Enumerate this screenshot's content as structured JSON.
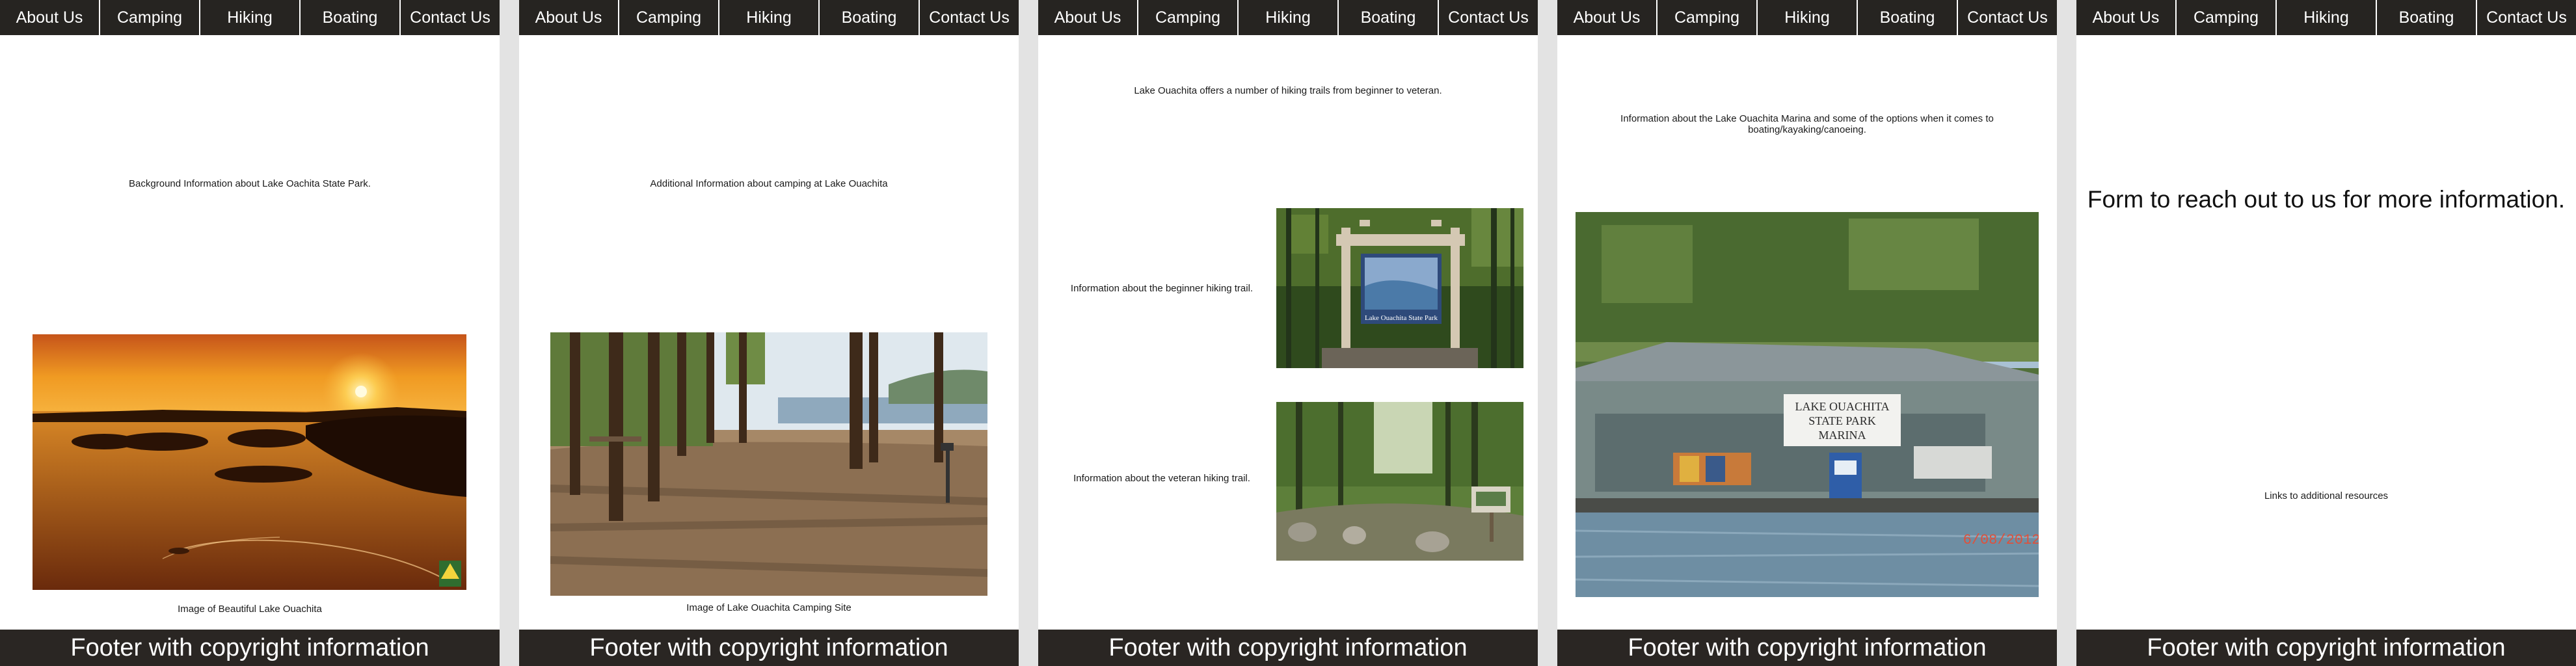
{
  "nav": [
    "About Us",
    "Camping",
    "Hiking",
    "Boating",
    "Contact Us"
  ],
  "footer": "Footer with copyright information",
  "about": {
    "intro": "Background Information about Lake Oachita State Park.",
    "caption": "Image of Beautiful Lake Ouachita"
  },
  "camping": {
    "intro": "Additional Information about camping at Lake Ouachita",
    "caption": "Image of Lake Ouachita Camping Site"
  },
  "hiking": {
    "intro": "Lake Ouachita offers a number of hiking trails from beginner to veteran.",
    "beginner": "Information about the beginner hiking trail.",
    "veteran": "Information about the veteran hiking trail.",
    "sign_text": "Lake Ouachita State Park"
  },
  "boating": {
    "intro": "Information about the Lake Ouachita Marina and some of the options when it comes to boating/kayaking/canoeing.",
    "sign_lines": [
      "LAKE OUACHITA",
      "STATE PARK",
      "MARINA"
    ],
    "date_stamp": "6/08/2012"
  },
  "contact": {
    "form": "Form to reach out to us for more information.",
    "links": "Links to additional resources"
  }
}
